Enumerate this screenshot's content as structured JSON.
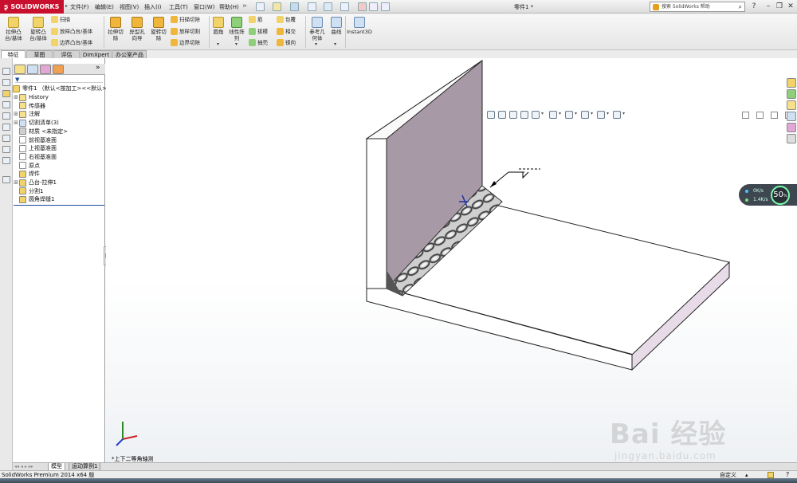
{
  "app": {
    "logo_text": "SOLIDWORKS",
    "document_title": "零件1 *",
    "search_placeholder": "搜索 SolidWorks 帮助"
  },
  "menu": [
    "文件(F)",
    "编辑(E)",
    "视图(V)",
    "插入(I)",
    "工具(T)",
    "窗口(W)",
    "帮助(H)"
  ],
  "command_manager": {
    "large_buttons": [
      {
        "label": "拉伸凸\n台/基体",
        "icon": "extrude-boss-icon"
      },
      {
        "label": "旋转凸\n台/基体",
        "icon": "revolve-boss-icon"
      },
      {
        "label": "拉伸切\n除",
        "icon": "extrude-cut-icon"
      },
      {
        "label": "异型孔\n向导",
        "icon": "hole-wizard-icon"
      },
      {
        "label": "旋转切\n除",
        "icon": "revolve-cut-icon"
      },
      {
        "label": "圆角",
        "icon": "fillet-icon"
      },
      {
        "label": "线性阵\n列",
        "icon": "linear-pattern-icon"
      },
      {
        "label": "参考几\n何体",
        "icon": "reference-geometry-icon"
      },
      {
        "label": "曲线",
        "icon": "curves-icon"
      },
      {
        "label": "Instant3D",
        "icon": "instant3d-icon"
      }
    ],
    "small_group_1": [
      "扫描",
      "放样凸台/基体",
      "边界凸台/基体"
    ],
    "small_group_2": [
      "扫描切除",
      "放样切割",
      "边界切除"
    ],
    "small_group_3": [
      "筋",
      "拔模",
      "抽壳"
    ],
    "small_group_4": [
      "包覆",
      "相交",
      "镜向"
    ]
  },
  "tabs": [
    "特征",
    "草图",
    "评估",
    "DimXpert",
    "办公室产品"
  ],
  "feature_tree": {
    "root": "零件1 （默认<按加工><<默认>",
    "items": [
      {
        "label": "History",
        "expandable": true,
        "icon": "history-icon"
      },
      {
        "label": "传感器",
        "expandable": false,
        "icon": "sensors-icon"
      },
      {
        "label": "注解",
        "expandable": true,
        "icon": "annotations-icon"
      },
      {
        "label": "切割清单(3)",
        "expandable": true,
        "icon": "cut-list-icon"
      },
      {
        "label": "材质 <未指定>",
        "expandable": false,
        "icon": "material-icon"
      },
      {
        "label": "前视基准面",
        "expandable": false,
        "icon": "plane-icon"
      },
      {
        "label": "上视基准面",
        "expandable": false,
        "icon": "plane-icon"
      },
      {
        "label": "右视基准面",
        "expandable": false,
        "icon": "plane-icon"
      },
      {
        "label": "原点",
        "expandable": false,
        "icon": "origin-icon"
      },
      {
        "label": "焊件",
        "expandable": false,
        "icon": "weldment-icon"
      },
      {
        "label": "凸台-拉伸1",
        "expandable": true,
        "icon": "extrude-feature-icon"
      },
      {
        "label": "分割1",
        "expandable": false,
        "icon": "split-icon"
      },
      {
        "label": "圆角焊缝1",
        "expandable": false,
        "icon": "fillet-bead-icon"
      }
    ]
  },
  "meter": {
    "down": "0K/s",
    "up": "1.4K/s",
    "percent": "50",
    "percent_unit": "%"
  },
  "viewport": {
    "view_name": "*上下二等角轴测"
  },
  "bottom_tabs": [
    "模型",
    "运动算例1"
  ],
  "status": {
    "left": "SolidWorks Premium 2014 x64 版",
    "right": "自定义"
  },
  "watermark": {
    "main": "Bai 经验",
    "sub": "jingyan.baidu.com"
  },
  "colors": {
    "brand": "#c8102e",
    "wall_face": "#a899a6",
    "plate_side": "#e8dbe8",
    "accent_blue": "#1a4d9a"
  }
}
